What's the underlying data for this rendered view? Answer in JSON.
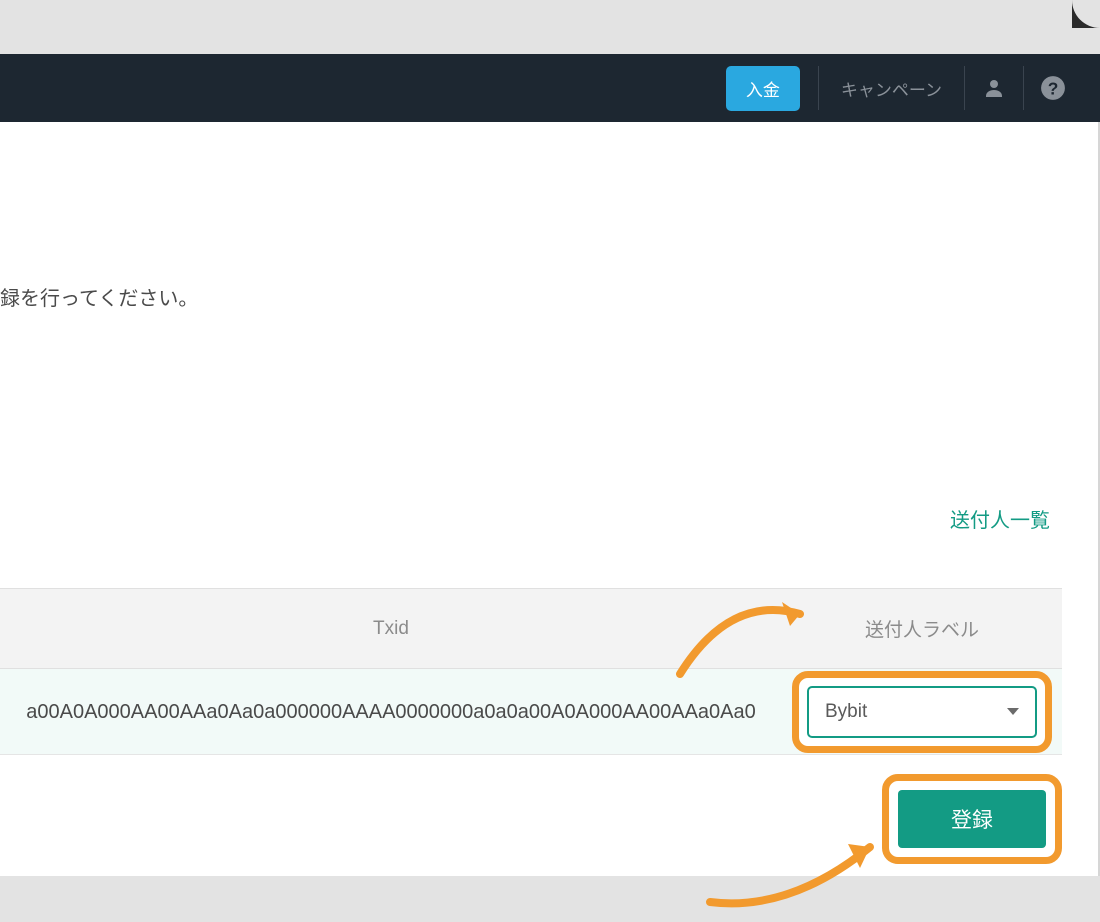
{
  "header": {
    "deposit_label": "入金",
    "campaign_label": "キャンペーン"
  },
  "content": {
    "instruction_fragment": "録を行ってください。",
    "sender_list_link": "送付人一覧"
  },
  "table": {
    "headers": {
      "txid": "Txid",
      "sender_label": "送付人ラベル"
    },
    "row": {
      "txid": "a00A0A000AA00AAa0Aa0a000000AAAA0000000a0a0a00A0A000AA00AAa0Aa0",
      "sender_select_value": "Bybit"
    }
  },
  "actions": {
    "register_label": "登録"
  },
  "icons": {
    "user": "user-icon",
    "help": "help-icon",
    "dropdown": "chevron-down-icon"
  },
  "colors": {
    "accent_teal": "#139b84",
    "accent_blue": "#2aa8e0",
    "highlight_orange": "#f29a2e",
    "header_bg": "#1d2731"
  }
}
